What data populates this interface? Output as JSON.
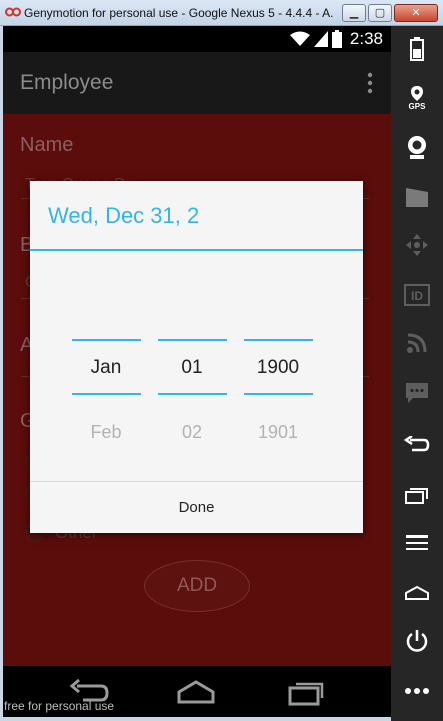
{
  "window": {
    "title": "Genymotion for personal use - Google Nexus 5 - 4.4.4 - A...",
    "min_label": "▁",
    "max_label": "▢",
    "close_label": "✕"
  },
  "status_bar": {
    "time": "2:38"
  },
  "app": {
    "title": "Employee"
  },
  "form": {
    "name_label": "Name",
    "name_value": "Tran Quang Du",
    "field2_label": "B",
    "field2_value": "C",
    "field3_label": "A",
    "gender_label": "G",
    "radio_other_label": "Other",
    "add_label": "ADD"
  },
  "dialog": {
    "title": "Wed, Dec 31, 2",
    "month_selected": "Jan",
    "day_selected": "01",
    "year_selected": "1900",
    "month_next": "Feb",
    "day_next": "02",
    "year_next": "1901",
    "done_label": "Done"
  },
  "watermark": "free for personal use",
  "side_toolbar": {
    "gps_label": "GPS",
    "id_label": "ID"
  },
  "colors": {
    "accent": "#33b5e5",
    "content_bg": "#5b0d0b",
    "action_bar": "#181818"
  }
}
